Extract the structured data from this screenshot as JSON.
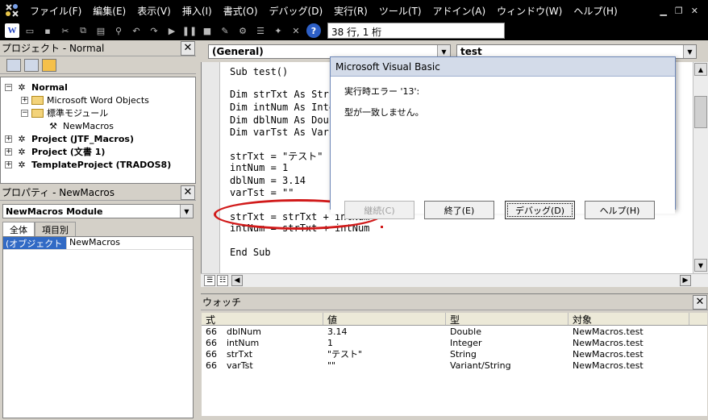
{
  "menubar": {
    "items": [
      "ファイル(F)",
      "編集(E)",
      "表示(V)",
      "挿入(I)",
      "書式(O)",
      "デバッグ(D)",
      "実行(R)",
      "ツール(T)",
      "アドイン(A)",
      "ウィンドウ(W)",
      "ヘルプ(H)"
    ]
  },
  "toolbar": {
    "position": "38 行, 1 桁"
  },
  "project_panel": {
    "title": "プロジェクト - Normal",
    "tree": [
      {
        "label": "Normal",
        "bold": true
      },
      {
        "label": "Microsoft Word Objects"
      },
      {
        "label": "標準モジュール"
      },
      {
        "label": "NewMacros"
      },
      {
        "label": "Project (JTF_Macros)",
        "bold": true
      },
      {
        "label": "Project (文書 1)",
        "bold": true
      },
      {
        "label": "TemplateProject (TRADOS8)",
        "bold": true
      }
    ]
  },
  "properties_panel": {
    "title": "プロパティ - NewMacros",
    "object_combo": "NewMacros Module",
    "tabs": [
      "全体",
      "項目別"
    ],
    "row": {
      "key": "(オブジェクト名)",
      "value": "NewMacros"
    }
  },
  "code_window": {
    "object_combo": "(General)",
    "proc_combo": "test",
    "lines": [
      "Sub test()",
      "Dim strTxt As Stri",
      "Dim intNum As Inte",
      "Dim dblNum As Doub",
      "Dim varTst As Vari",
      "strTxt = \"テスト\"",
      "intNum = 1",
      "dblNum = 3.14",
      "varTst = \"\"",
      "strTxt = strTxt + intNum",
      "intNum = strTxt + intNum",
      "End Sub"
    ]
  },
  "watch_panel": {
    "title": "ウォッチ",
    "headers": [
      "式",
      "値",
      "型",
      "対象"
    ],
    "rows": [
      {
        "expr": "dblNum",
        "value": "3.14",
        "type": "Double",
        "context": "NewMacros.test"
      },
      {
        "expr": "intNum",
        "value": "1",
        "type": "Integer",
        "context": "NewMacros.test"
      },
      {
        "expr": "strTxt",
        "value": "\"テスト\"",
        "type": "String",
        "context": "NewMacros.test"
      },
      {
        "expr": "varTst",
        "value": "\"\"",
        "type": "Variant/String",
        "context": "NewMacros.test"
      }
    ]
  },
  "dialog": {
    "title": "Microsoft Visual Basic",
    "error_line": "実行時エラー '13':",
    "message": "型が一致しません。",
    "buttons": {
      "continue": "継続(C)",
      "end": "終了(E)",
      "debug": "デバッグ(D)",
      "help": "ヘルプ(H)"
    }
  },
  "colors": {
    "annotation": "#d11a1a",
    "selection": "#316ac5"
  }
}
